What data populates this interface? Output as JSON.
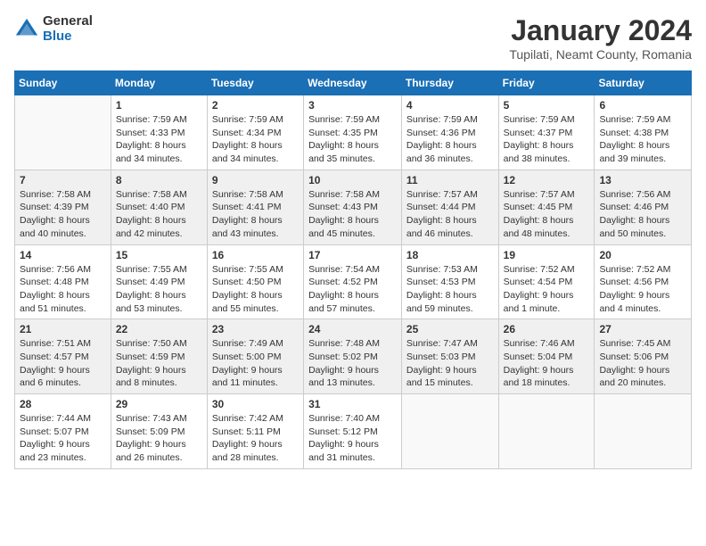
{
  "header": {
    "logo_general": "General",
    "logo_blue": "Blue",
    "title": "January 2024",
    "location": "Tupilati, Neamt County, Romania"
  },
  "weekdays": [
    "Sunday",
    "Monday",
    "Tuesday",
    "Wednesday",
    "Thursday",
    "Friday",
    "Saturday"
  ],
  "weeks": [
    [
      {
        "day": "",
        "content": ""
      },
      {
        "day": "1",
        "content": "Sunrise: 7:59 AM\nSunset: 4:33 PM\nDaylight: 8 hours\nand 34 minutes."
      },
      {
        "day": "2",
        "content": "Sunrise: 7:59 AM\nSunset: 4:34 PM\nDaylight: 8 hours\nand 34 minutes."
      },
      {
        "day": "3",
        "content": "Sunrise: 7:59 AM\nSunset: 4:35 PM\nDaylight: 8 hours\nand 35 minutes."
      },
      {
        "day": "4",
        "content": "Sunrise: 7:59 AM\nSunset: 4:36 PM\nDaylight: 8 hours\nand 36 minutes."
      },
      {
        "day": "5",
        "content": "Sunrise: 7:59 AM\nSunset: 4:37 PM\nDaylight: 8 hours\nand 38 minutes."
      },
      {
        "day": "6",
        "content": "Sunrise: 7:59 AM\nSunset: 4:38 PM\nDaylight: 8 hours\nand 39 minutes."
      }
    ],
    [
      {
        "day": "7",
        "content": "Sunrise: 7:58 AM\nSunset: 4:39 PM\nDaylight: 8 hours\nand 40 minutes."
      },
      {
        "day": "8",
        "content": "Sunrise: 7:58 AM\nSunset: 4:40 PM\nDaylight: 8 hours\nand 42 minutes."
      },
      {
        "day": "9",
        "content": "Sunrise: 7:58 AM\nSunset: 4:41 PM\nDaylight: 8 hours\nand 43 minutes."
      },
      {
        "day": "10",
        "content": "Sunrise: 7:58 AM\nSunset: 4:43 PM\nDaylight: 8 hours\nand 45 minutes."
      },
      {
        "day": "11",
        "content": "Sunrise: 7:57 AM\nSunset: 4:44 PM\nDaylight: 8 hours\nand 46 minutes."
      },
      {
        "day": "12",
        "content": "Sunrise: 7:57 AM\nSunset: 4:45 PM\nDaylight: 8 hours\nand 48 minutes."
      },
      {
        "day": "13",
        "content": "Sunrise: 7:56 AM\nSunset: 4:46 PM\nDaylight: 8 hours\nand 50 minutes."
      }
    ],
    [
      {
        "day": "14",
        "content": "Sunrise: 7:56 AM\nSunset: 4:48 PM\nDaylight: 8 hours\nand 51 minutes."
      },
      {
        "day": "15",
        "content": "Sunrise: 7:55 AM\nSunset: 4:49 PM\nDaylight: 8 hours\nand 53 minutes."
      },
      {
        "day": "16",
        "content": "Sunrise: 7:55 AM\nSunset: 4:50 PM\nDaylight: 8 hours\nand 55 minutes."
      },
      {
        "day": "17",
        "content": "Sunrise: 7:54 AM\nSunset: 4:52 PM\nDaylight: 8 hours\nand 57 minutes."
      },
      {
        "day": "18",
        "content": "Sunrise: 7:53 AM\nSunset: 4:53 PM\nDaylight: 8 hours\nand 59 minutes."
      },
      {
        "day": "19",
        "content": "Sunrise: 7:52 AM\nSunset: 4:54 PM\nDaylight: 9 hours\nand 1 minute."
      },
      {
        "day": "20",
        "content": "Sunrise: 7:52 AM\nSunset: 4:56 PM\nDaylight: 9 hours\nand 4 minutes."
      }
    ],
    [
      {
        "day": "21",
        "content": "Sunrise: 7:51 AM\nSunset: 4:57 PM\nDaylight: 9 hours\nand 6 minutes."
      },
      {
        "day": "22",
        "content": "Sunrise: 7:50 AM\nSunset: 4:59 PM\nDaylight: 9 hours\nand 8 minutes."
      },
      {
        "day": "23",
        "content": "Sunrise: 7:49 AM\nSunset: 5:00 PM\nDaylight: 9 hours\nand 11 minutes."
      },
      {
        "day": "24",
        "content": "Sunrise: 7:48 AM\nSunset: 5:02 PM\nDaylight: 9 hours\nand 13 minutes."
      },
      {
        "day": "25",
        "content": "Sunrise: 7:47 AM\nSunset: 5:03 PM\nDaylight: 9 hours\nand 15 minutes."
      },
      {
        "day": "26",
        "content": "Sunrise: 7:46 AM\nSunset: 5:04 PM\nDaylight: 9 hours\nand 18 minutes."
      },
      {
        "day": "27",
        "content": "Sunrise: 7:45 AM\nSunset: 5:06 PM\nDaylight: 9 hours\nand 20 minutes."
      }
    ],
    [
      {
        "day": "28",
        "content": "Sunrise: 7:44 AM\nSunset: 5:07 PM\nDaylight: 9 hours\nand 23 minutes."
      },
      {
        "day": "29",
        "content": "Sunrise: 7:43 AM\nSunset: 5:09 PM\nDaylight: 9 hours\nand 26 minutes."
      },
      {
        "day": "30",
        "content": "Sunrise: 7:42 AM\nSunset: 5:11 PM\nDaylight: 9 hours\nand 28 minutes."
      },
      {
        "day": "31",
        "content": "Sunrise: 7:40 AM\nSunset: 5:12 PM\nDaylight: 9 hours\nand 31 minutes."
      },
      {
        "day": "",
        "content": ""
      },
      {
        "day": "",
        "content": ""
      },
      {
        "day": "",
        "content": ""
      }
    ]
  ]
}
